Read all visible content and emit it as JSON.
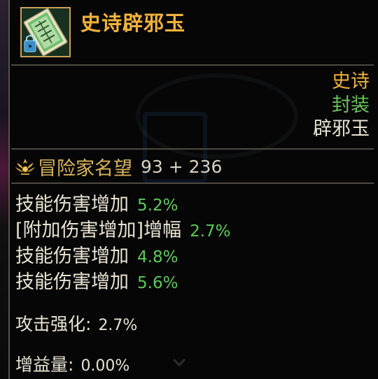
{
  "item": {
    "name": "史诗辟邪玉",
    "icon": "jade-talisman-icon",
    "lock_icon": "lock-icon",
    "rarity": "史诗",
    "seal_status": "封装",
    "type": "辟邪玉"
  },
  "fame": {
    "icon": "fame-crest-icon",
    "label": "冒险家名望",
    "value": "93 + 236"
  },
  "stats": [
    {
      "label": "技能伤害增加",
      "value": "5.2%"
    },
    {
      "label": "[附加伤害增加]增幅",
      "value": "2.7%"
    },
    {
      "label": "技能伤害增加",
      "value": "4.8%"
    },
    {
      "label": "技能伤害增加",
      "value": "5.6%"
    }
  ],
  "extra": [
    {
      "label": "攻击强化:",
      "value": "2.7%"
    },
    {
      "label": "增益量:",
      "value": "0.00%"
    }
  ],
  "colors": {
    "rarity": "#f0b23c",
    "seal": "#6bc35a",
    "stat_value": "#5fc95b",
    "text": "#e8e2d2",
    "fame_label": "#d8b35a"
  }
}
